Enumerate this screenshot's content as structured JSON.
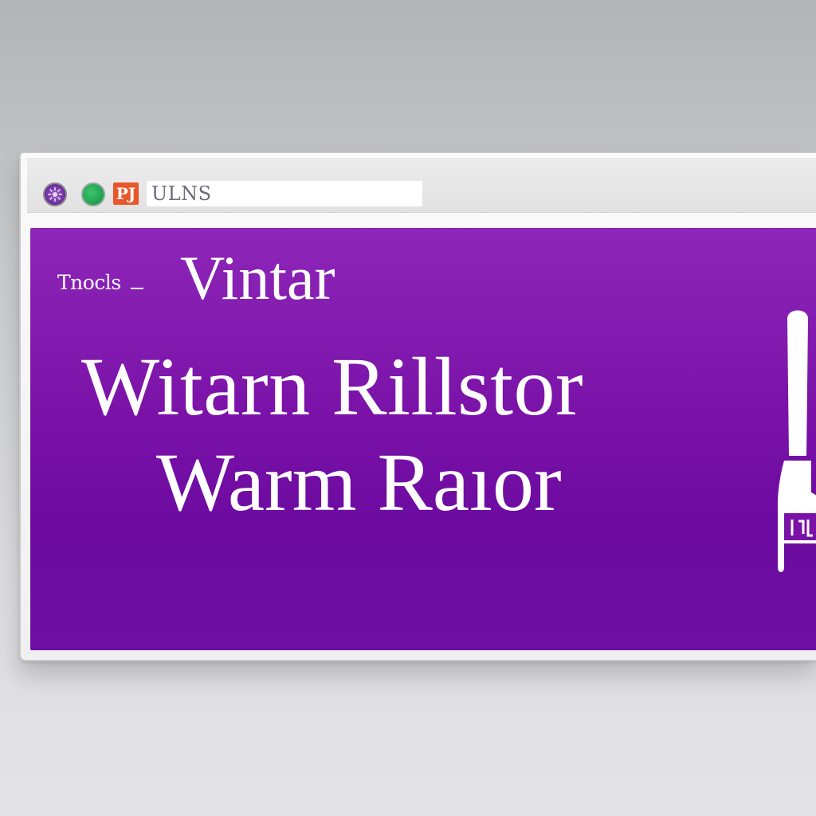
{
  "window": {
    "address_text": "ULNS",
    "favicon_text": "PJ"
  },
  "banner": {
    "small_label": "Tnocls",
    "heading_top": "Vintar",
    "heading_main": "Witarn Rillstor",
    "heading_sub": "Warm Raıor"
  },
  "icons": {
    "window_controls": [
      "gear-icon",
      "green-dot-icon"
    ],
    "side_graphic": "brush-icon"
  },
  "colors": {
    "banner_purple": "#7a12a8",
    "control_green": "#1f9a4a",
    "favicon_orange": "#e8572a"
  }
}
